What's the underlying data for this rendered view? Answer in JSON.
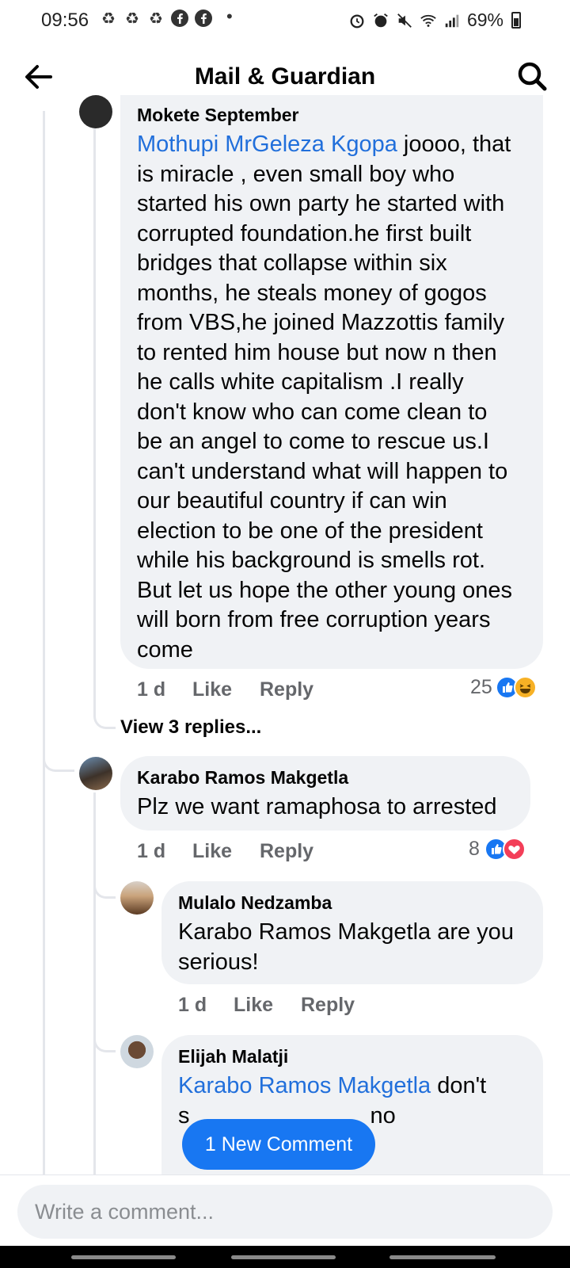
{
  "status_bar": {
    "time": "09:56",
    "battery": "69%",
    "icons": [
      "recycle-icon",
      "recycle-icon",
      "recycle-icon",
      "facebook-icon",
      "facebook-icon"
    ]
  },
  "header": {
    "title": "Mail & Guardian"
  },
  "comments": [
    {
      "author": "Mokete September",
      "mention": "Mothupi MrGeleza Kgopa",
      "text_lines": [
        " joooo, that",
        "is miracle , even small boy who",
        "started his own party he started with",
        "corrupted foundation.he first built",
        "bridges that collapse within six",
        "months, he steals money of gogos",
        "from  VBS,he joined Mazzottis family",
        "to rented him house but now n then",
        "he calls white capitalism .I really",
        "don't know who can come clean to",
        "be an angel to come to rescue us.I",
        "can't understand what will happen to",
        "our beautiful country if can win",
        "election to be one of the president",
        "while his background is smells rot.",
        "But let us hope the other young ones",
        "will born from free corruption years",
        "come"
      ],
      "time": "1 d",
      "like": "Like",
      "reply": "Reply",
      "reaction_count": "25",
      "reactions": [
        "like",
        "haha"
      ],
      "view_replies": "View 3 replies..."
    },
    {
      "author": "Karabo Ramos Makgetla",
      "text": "Plz we want ramaphosa to arrested",
      "time": "1 d",
      "like": "Like",
      "reply": "Reply",
      "reaction_count": "8",
      "reactions": [
        "like",
        "love"
      ]
    },
    {
      "author": "Mulalo Nedzamba",
      "text_lines": [
        "Karabo Ramos Makgetla are you",
        "serious!"
      ],
      "time": "1 d",
      "like": "Like",
      "reply": "Reply"
    },
    {
      "author": "Elijah Malatji",
      "mention": "Karabo Ramos Makgetla",
      "text_after": " don't",
      "line2_start": "s",
      "line2_end": "no"
    }
  ],
  "new_comment_button": "1 New Comment",
  "comment_input": {
    "placeholder": "Write a comment..."
  },
  "colors": {
    "accent": "#1877f2",
    "mention": "#216fdb",
    "bubble": "#f0f2f5",
    "meta": "#65676b"
  }
}
